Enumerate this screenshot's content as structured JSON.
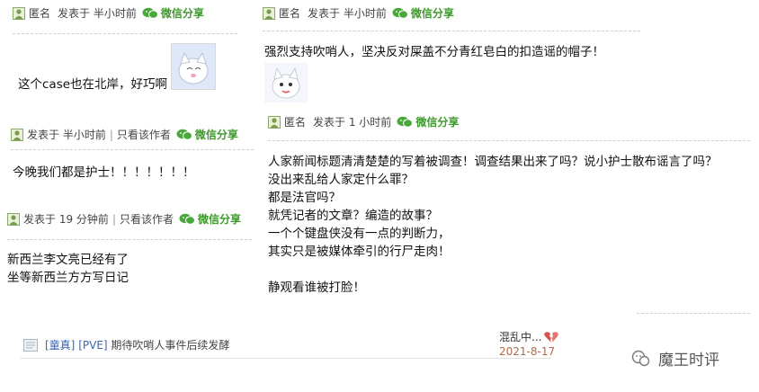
{
  "comments": [
    {
      "author": "匿名",
      "posted": "发表于",
      "time": "半小时前",
      "share": "微信分享",
      "lines": [
        "这个case也在北岸，好巧啊"
      ]
    },
    {
      "posted": "发表于",
      "time": "半小时前",
      "only_author": "只看该作者",
      "share": "微信分享",
      "lines": [
        "今晚我们都是护士！！！！！！！"
      ]
    },
    {
      "posted": "发表于",
      "time": "19 分钟前",
      "only_author": "只看该作者",
      "share": "微信分享",
      "lines": [
        "新西兰李文亮已经有了",
        "坐等新西兰方方写日记"
      ]
    },
    {
      "author": "匿名",
      "posted": "发表于",
      "time": "半小时前",
      "share": "微信分享",
      "lines": [
        "强烈支持吹哨人，坚决反对屎盖不分青红皂白的扣造谣的帽子！"
      ]
    },
    {
      "author": "匿名",
      "posted": "发表于",
      "time": "1 小时前",
      "share": "微信分享",
      "lines": [
        "人家新闻标题清清楚楚的写着被调查！调查结果出来了吗？说小护士散布谣言了吗？",
        "没出来乱给人家定什么罪？",
        "都是法官吗？",
        "就凭记者的文章？编造的故事？",
        "一个个键盘侠没有一点的判断力，",
        "其实只是被媒体牵引的行尸走肉！",
        "",
        "静观看谁被打脸！"
      ]
    }
  ],
  "footer": {
    "tag1": "[童真]",
    "tag2": "[PVE]",
    "title": "期待吹哨人事件后续发酵",
    "last_user": "混乱中...",
    "date": "2021-8-17"
  },
  "watermark": "魔王时评",
  "colors": {
    "share_green": "#3c9a2a",
    "link_blue": "#3b64b0",
    "date_rust": "#b06a4b"
  }
}
